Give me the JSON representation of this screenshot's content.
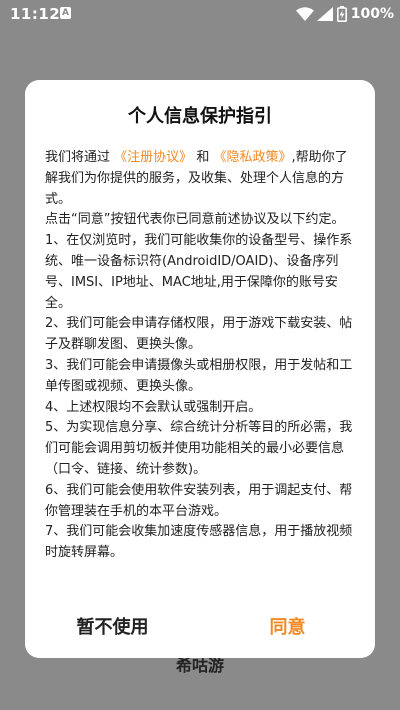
{
  "status_bar": {
    "time": "11:12",
    "battery": "100%",
    "icons": [
      "notification-a-icon",
      "wifi-icon",
      "signal-icon",
      "battery-charging-icon"
    ]
  },
  "background": {
    "app_name": "希咕游"
  },
  "dialog": {
    "title": "个人信息保护指引",
    "intro": {
      "prefix": "我们将通过",
      "link_register": "《注册协议》",
      "and": "和",
      "link_privacy": "《隐私政策》",
      "suffix": ",帮助你了解我们为你提供的服务，及收集、处理个人信息的方式。"
    },
    "consent_note": " 点击“同意”按钮代表你已同意前述协议及以下约定。",
    "items": [
      " 1、在仅浏览时，我们可能收集你的设备型号、操作系统、唯一设备标识符(AndroidID/OAID)、设备序列号、IMSI、IP地址、MAC地址,用于保障你的账号安全。",
      " 2、我们可能会申请存储权限，用于游戏下载安装、帖子及群聊发图、更换头像。",
      " 3、我们可能会申请摄像头或相册权限，用于发帖和工单传图或视频、更换头像。",
      " 4、上述权限均不会默认或强制开启。",
      " 5、为实现信息分享、综合统计分析等目的所必需，我们可能会调用剪切板并使用功能相关的最小必要信息（口令、链接、统计参数)。",
      " 6、我们可能会使用软件安装列表，用于调起支付、帮你管理装在手机的本平台游戏。",
      " 7、我们可能会收集加速度传感器信息，用于播放视频时旋转屏幕。"
    ],
    "decline_label": "暂不使用",
    "agree_label": "同意"
  },
  "colors": {
    "accent": "#f08a24",
    "overlay": "#8a8a8a",
    "dialog_bg": "#ffffff",
    "text": "#222222"
  }
}
